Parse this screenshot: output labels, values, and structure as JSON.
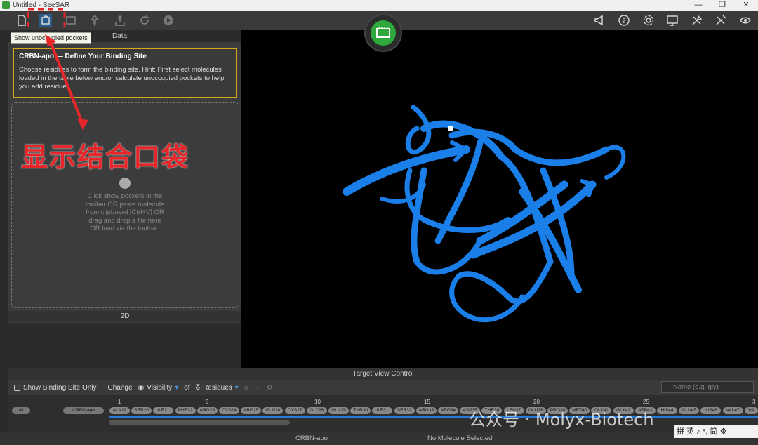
{
  "window": {
    "title": "Untitled - SeeSAR"
  },
  "window_buttons": [
    "—",
    "❐",
    "✕"
  ],
  "tooltip": "Show unoccupied pockets",
  "tabs": {
    "data": "Data"
  },
  "hint": {
    "title": "CRBN-apo — Define Your Binding Site",
    "body": "Choose residues to form the binding site. Hint: First select molecules loaded in the table below and/or calculate unoccupied pockets to help you add residues."
  },
  "dropzone_text": "Click show pockets in the toolbar OR paste molecule from clipboard [Ctrl+V] OR drag and drop a file here OR load via the toolbar.",
  "panel_2d": "2D",
  "annotation": "显示结合口袋",
  "target_view_control": "Target View Control",
  "controls": {
    "show_binding_site_only": "Show Binding Site Only",
    "change": "Change",
    "visibility": "Visibility",
    "of": "of",
    "residues": "Residues",
    "search_placeholder": "Name (e.g. gly)"
  },
  "sequence": {
    "all": "all",
    "chain": "CRBN-apo",
    "numbers": [
      "1",
      "5",
      "10",
      "15",
      "20",
      "25",
      "3"
    ],
    "residues": [
      "ALA19",
      "SER20",
      "ILE21",
      "PHE22",
      "ARG23",
      "CYS24",
      "ARG25",
      "GLN26",
      "CYS27",
      "GLY28",
      "GLN29",
      "THR30",
      "ILE31",
      "SER32",
      "ARG33",
      "ARG34",
      "ASP35",
      "THR36",
      "LEU37",
      "GLU38",
      "PRO39",
      "MET40",
      "GLY41",
      "GLY42",
      "ASP43",
      "HIS44",
      "GLU45",
      "HIS46",
      "VAL47",
      "VA"
    ]
  },
  "status": {
    "left": "CRBN-apo",
    "right": "No Molecule Selected"
  },
  "watermark": "公众号 · Molyx-Biotech",
  "ime": "拼 英 ♪ ⁹, 简 ⚙",
  "colors": {
    "ribbon": "#1a7fe8",
    "accent_green": "#2ea83a",
    "highlight": "#d4a91c",
    "annotation_red": "#e8262a"
  }
}
